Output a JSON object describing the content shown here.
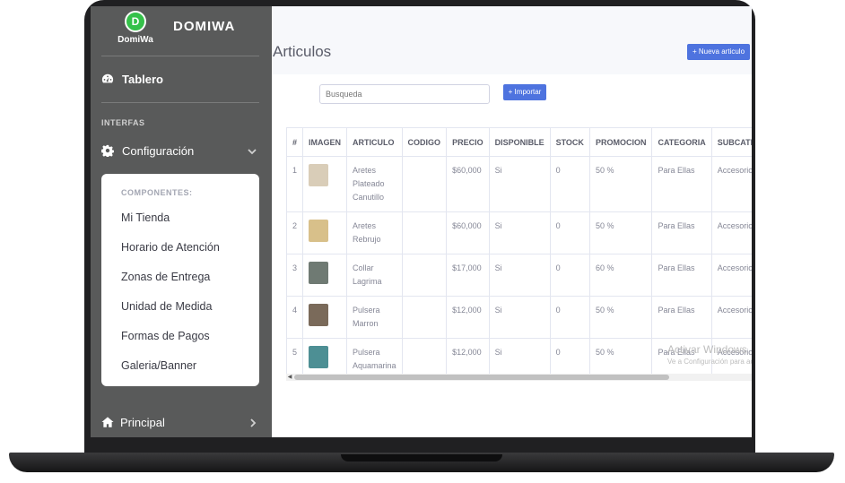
{
  "brand": {
    "logo_letter": "D",
    "logo_text": "DomiWa",
    "title": "DOMIWA"
  },
  "sidebar": {
    "dashboard_label": "Tablero",
    "section_heading": "INTERFAS",
    "config_label": "Configuración",
    "submenu_heading": "COMPONENTES:",
    "submenu_items": [
      {
        "label": "Mi Tienda"
      },
      {
        "label": "Horario de Atención"
      },
      {
        "label": "Zonas de Entrega"
      },
      {
        "label": "Unidad de Medida"
      },
      {
        "label": "Formas de Pagos"
      },
      {
        "label": "Galeria/Banner"
      }
    ],
    "principal_label": "Principal"
  },
  "page": {
    "title": "Articulos",
    "new_article_button": "+ Nueva articulo",
    "search_placeholder": "Busqueda",
    "import_button": "+ Importar"
  },
  "table": {
    "columns": [
      "#",
      "IMAGEN",
      "ARTICULO",
      "CODIGO",
      "PRECIO",
      "DISPONIBLE",
      "STOCK",
      "PROMOCION",
      "CATEGORIA",
      "SUBCATEGORIA"
    ],
    "rows": [
      {
        "num": "1",
        "articulo": "Aretes Plateado Canutillo",
        "codigo": "",
        "precio": "$60,000",
        "disponible": "Si",
        "stock": "0",
        "promocion": "50 %",
        "categoria": "Para Ellas",
        "subcategoria": "Accesorios",
        "thumb_color": "#d9cdb8"
      },
      {
        "num": "2",
        "articulo": "Aretes Rebrujo",
        "codigo": "",
        "precio": "$60,000",
        "disponible": "Si",
        "stock": "0",
        "promocion": "50 %",
        "categoria": "Para Ellas",
        "subcategoria": "Accesorios",
        "thumb_color": "#d8c08a"
      },
      {
        "num": "3",
        "articulo": "Collar Lagrima",
        "codigo": "",
        "precio": "$17,000",
        "disponible": "Si",
        "stock": "0",
        "promocion": "60 %",
        "categoria": "Para Ellas",
        "subcategoria": "Accesorios",
        "thumb_color": "#6f7a73"
      },
      {
        "num": "4",
        "articulo": "Pulsera Marron",
        "codigo": "",
        "precio": "$12,000",
        "disponible": "Si",
        "stock": "0",
        "promocion": "50 %",
        "categoria": "Para Ellas",
        "subcategoria": "Accesorios",
        "thumb_color": "#7a6a5a"
      },
      {
        "num": "5",
        "articulo": "Pulsera Aquamarina",
        "codigo": "",
        "precio": "$12,000",
        "disponible": "Si",
        "stock": "0",
        "promocion": "50 %",
        "categoria": "Para Ellas",
        "subcategoria": "Accesorios",
        "thumb_color": "#4d8f94"
      }
    ]
  },
  "watermark": {
    "title": "Activar Windows",
    "subtitle": "Ve a Configuración para activar Windows."
  },
  "colors": {
    "sidebar": "#595a5a",
    "primary": "#4e73df",
    "brand_green": "#35c14a"
  }
}
